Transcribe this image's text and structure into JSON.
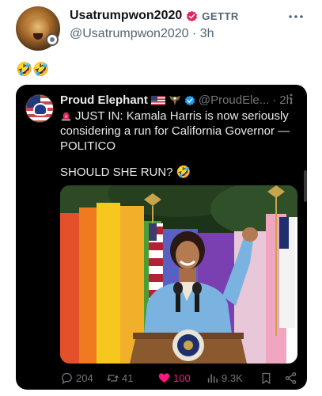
{
  "post": {
    "author_name": "Usatrumpwon2020",
    "platform_label": "GETTR",
    "handle": "@Usatrumpwon2020",
    "separator": "·",
    "time": "3h",
    "more_icon": "more-horizontal-icon",
    "text": "🤣🤣"
  },
  "quote": {
    "author_name": "Proud Elephant",
    "handle": "@ProudEle...",
    "separator": "·",
    "time": "2h",
    "text_line": "JUST IN: Kamala Harris is now seriously considering a run for California Governor — POLITICO",
    "question": "SHOULD SHE RUN? 🤣"
  },
  "actions": {
    "reply_count": "204",
    "repost_count": "41",
    "like_count": "100",
    "views_count": "9.3K"
  },
  "colors": {
    "like": "#f91880",
    "verified_blue": "#1d9bf0",
    "gettr_red": "#e0245e",
    "quote_bg": "#000000",
    "muted": "#71767b"
  }
}
